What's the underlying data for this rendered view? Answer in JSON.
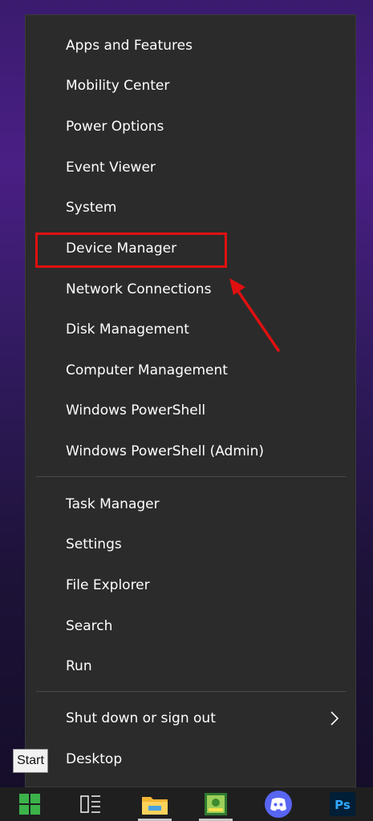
{
  "menu": {
    "group1": [
      {
        "label": "Apps and Features"
      },
      {
        "label": "Mobility Center"
      },
      {
        "label": "Power Options"
      },
      {
        "label": "Event Viewer"
      },
      {
        "label": "System"
      },
      {
        "label": "Device Manager"
      },
      {
        "label": "Network Connections"
      },
      {
        "label": "Disk Management"
      },
      {
        "label": "Computer Management"
      },
      {
        "label": "Windows PowerShell"
      },
      {
        "label": "Windows PowerShell (Admin)"
      }
    ],
    "group2": [
      {
        "label": "Task Manager"
      },
      {
        "label": "Settings"
      },
      {
        "label": "File Explorer"
      },
      {
        "label": "Search"
      },
      {
        "label": "Run"
      }
    ],
    "group3": [
      {
        "label": "Shut down or sign out",
        "submenu_icon": "chevron-right-icon"
      },
      {
        "label": "Desktop"
      }
    ]
  },
  "tooltip": {
    "text": "Start"
  },
  "annotation": {
    "highlighted_item": "Device Manager",
    "color": "#e01010"
  },
  "taskbar": {
    "items": [
      {
        "icon": "windows-start-icon"
      },
      {
        "icon": "task-view-icon"
      },
      {
        "icon": "file-explorer-icon"
      },
      {
        "icon": "app-icon"
      },
      {
        "icon": "discord-icon"
      },
      {
        "icon": "photoshop-icon",
        "text": "Ps"
      }
    ]
  },
  "colors": {
    "menu_bg": "#2b2b2b",
    "text": "#ffffff",
    "accent": "#e01010"
  }
}
